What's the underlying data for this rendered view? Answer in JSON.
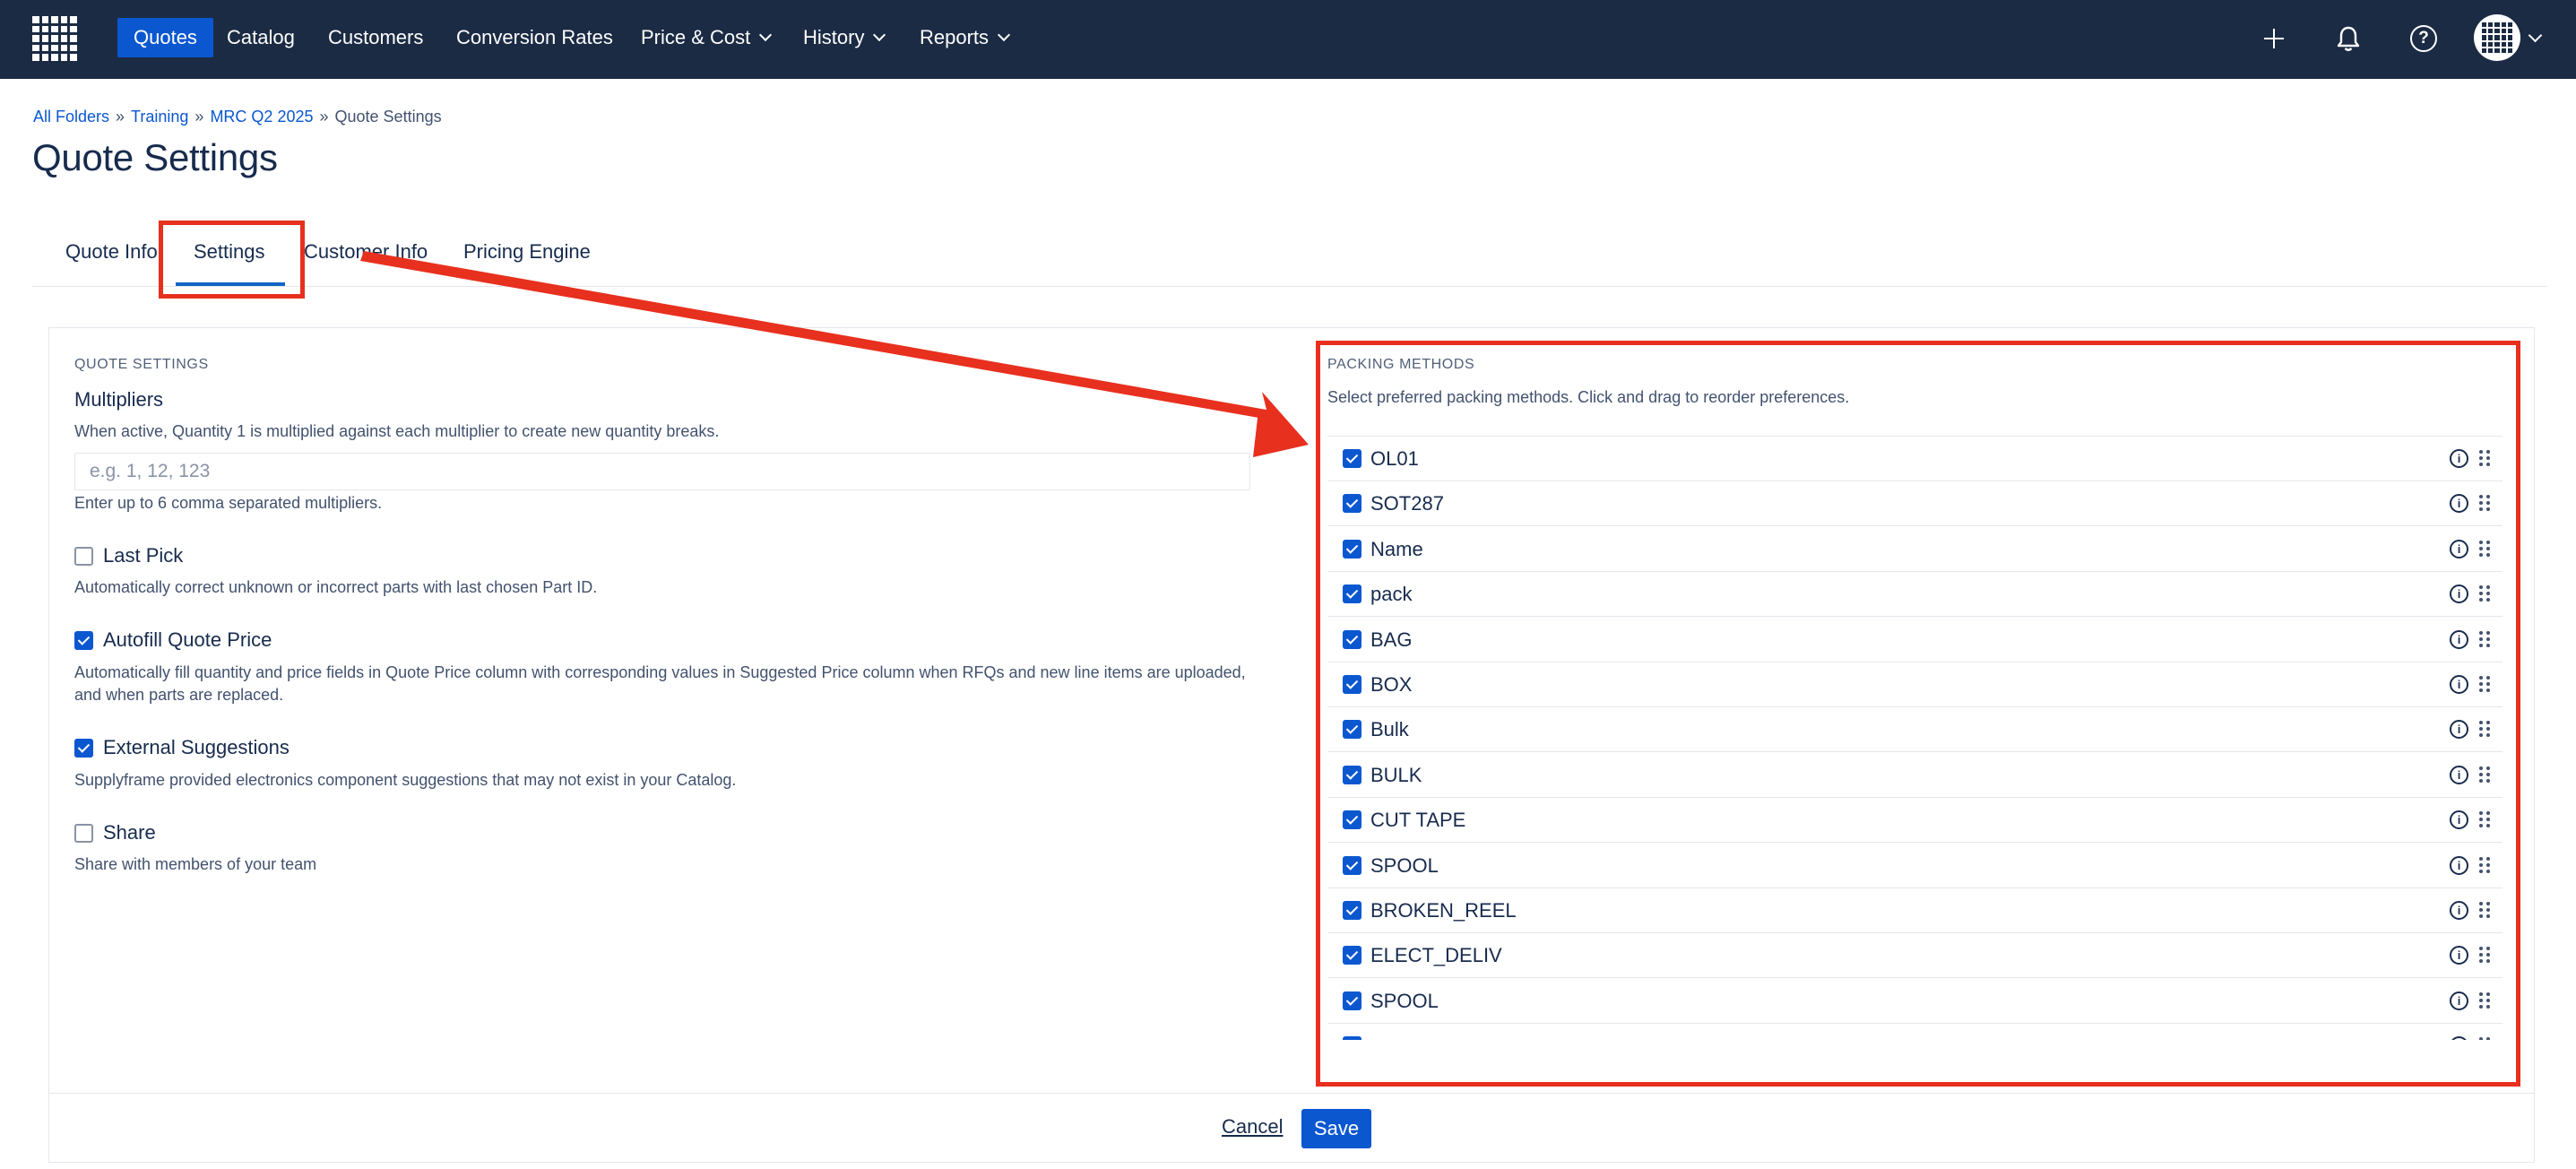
{
  "nav": {
    "items": [
      {
        "label": "Quotes",
        "active": true
      },
      {
        "label": "Catalog"
      },
      {
        "label": "Customers"
      },
      {
        "label": "Conversion Rates"
      },
      {
        "label": "Price & Cost",
        "dropdown": true
      },
      {
        "label": "History",
        "dropdown": true
      },
      {
        "label": "Reports",
        "dropdown": true
      }
    ],
    "icons": [
      "plus-icon",
      "bell-icon",
      "help-icon",
      "avatar"
    ]
  },
  "breadcrumb": {
    "items": [
      "All Folders",
      "Training",
      "MRC Q2 2025"
    ],
    "current": "Quote Settings",
    "separator": "»"
  },
  "page": {
    "title": "Quote Settings"
  },
  "tabs": [
    {
      "label": "Quote Info"
    },
    {
      "label": "Settings",
      "active": true
    },
    {
      "label": "Customer Info"
    },
    {
      "label": "Pricing Engine"
    }
  ],
  "quote_settings": {
    "heading": "QUOTE SETTINGS",
    "multipliers": {
      "label": "Multipliers",
      "description": "When active, Quantity 1 is multiplied against each multiplier to create new quantity breaks.",
      "placeholder": "e.g. 1, 12, 123",
      "value": "",
      "help": "Enter up to 6 comma separated multipliers."
    },
    "options": [
      {
        "label": "Last Pick",
        "checked": false,
        "description": "Automatically correct unknown or incorrect parts with last chosen Part ID."
      },
      {
        "label": "Autofill Quote Price",
        "checked": true,
        "description": "Automatically fill quantity and price fields in Quote Price column with corresponding values in Suggested Price column when RFQs and new line items are uploaded, and when parts are replaced."
      },
      {
        "label": "External Suggestions",
        "checked": true,
        "description": "Supplyframe provided electronics component suggestions that may not exist in your Catalog."
      },
      {
        "label": "Share",
        "checked": false,
        "description": "Share with members of your team"
      }
    ]
  },
  "packing_methods": {
    "heading": "PACKING METHODS",
    "description": "Select preferred packing methods. Click and drag to reorder preferences.",
    "items": [
      {
        "label": "OL01",
        "checked": true
      },
      {
        "label": "SOT287",
        "checked": true
      },
      {
        "label": "Name",
        "checked": true
      },
      {
        "label": "pack",
        "checked": true
      },
      {
        "label": "BAG",
        "checked": true
      },
      {
        "label": "BOX",
        "checked": true
      },
      {
        "label": "Bulk",
        "checked": true
      },
      {
        "label": "BULK",
        "checked": true
      },
      {
        "label": "CUT TAPE",
        "checked": true
      },
      {
        "label": "SPOOL",
        "checked": true
      },
      {
        "label": "BROKEN_REEL",
        "checked": true
      },
      {
        "label": "ELECT_DELIV",
        "checked": true
      },
      {
        "label": "SPOOL",
        "checked": true
      },
      {
        "label": "",
        "checked": true
      }
    ]
  },
  "footer": {
    "cancel_label": "Cancel",
    "save_label": "Save"
  },
  "colors": {
    "nav_bg": "#1b2b44",
    "accent": "#0b57d0",
    "annotation": "#e8301e"
  }
}
